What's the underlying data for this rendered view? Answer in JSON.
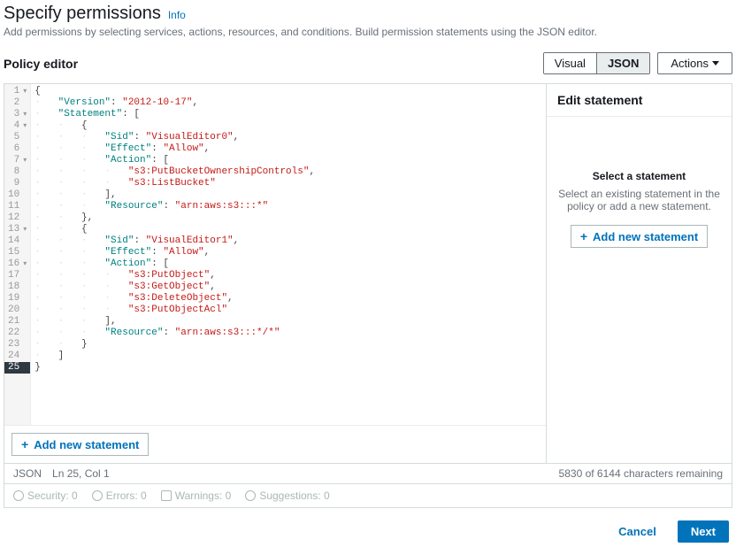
{
  "header": {
    "title": "Specify permissions",
    "info": "Info",
    "subtitle": "Add permissions by selecting services, actions, resources, and conditions. Build permission statements using the JSON editor."
  },
  "editor": {
    "title": "Policy editor",
    "toggle": {
      "visual": "Visual",
      "json": "JSON"
    },
    "actions": "Actions",
    "addStatement": "Add new statement"
  },
  "code": {
    "lines": [
      {
        "n": 1,
        "fold": true,
        "indent": 0,
        "content": "{"
      },
      {
        "n": 2,
        "fold": false,
        "indent": 1,
        "content": "\"Version\": \"2012-10-17\","
      },
      {
        "n": 3,
        "fold": true,
        "indent": 1,
        "content": "\"Statement\": ["
      },
      {
        "n": 4,
        "fold": true,
        "indent": 2,
        "content": "{"
      },
      {
        "n": 5,
        "fold": false,
        "indent": 3,
        "content": "\"Sid\": \"VisualEditor0\","
      },
      {
        "n": 6,
        "fold": false,
        "indent": 3,
        "content": "\"Effect\": \"Allow\","
      },
      {
        "n": 7,
        "fold": true,
        "indent": 3,
        "content": "\"Action\": ["
      },
      {
        "n": 8,
        "fold": false,
        "indent": 4,
        "content": "\"s3:PutBucketOwnershipControls\","
      },
      {
        "n": 9,
        "fold": false,
        "indent": 4,
        "content": "\"s3:ListBucket\""
      },
      {
        "n": 10,
        "fold": false,
        "indent": 3,
        "content": "],"
      },
      {
        "n": 11,
        "fold": false,
        "indent": 3,
        "content": "\"Resource\": \"arn:aws:s3:::*\""
      },
      {
        "n": 12,
        "fold": false,
        "indent": 2,
        "content": "},"
      },
      {
        "n": 13,
        "fold": true,
        "indent": 2,
        "content": "{"
      },
      {
        "n": 14,
        "fold": false,
        "indent": 3,
        "content": "\"Sid\": \"VisualEditor1\","
      },
      {
        "n": 15,
        "fold": false,
        "indent": 3,
        "content": "\"Effect\": \"Allow\","
      },
      {
        "n": 16,
        "fold": true,
        "indent": 3,
        "content": "\"Action\": ["
      },
      {
        "n": 17,
        "fold": false,
        "indent": 4,
        "content": "\"s3:PutObject\","
      },
      {
        "n": 18,
        "fold": false,
        "indent": 4,
        "content": "\"s3:GetObject\","
      },
      {
        "n": 19,
        "fold": false,
        "indent": 4,
        "content": "\"s3:DeleteObject\","
      },
      {
        "n": 20,
        "fold": false,
        "indent": 4,
        "content": "\"s3:PutObjectAcl\""
      },
      {
        "n": 21,
        "fold": false,
        "indent": 3,
        "content": "],"
      },
      {
        "n": 22,
        "fold": false,
        "indent": 3,
        "content": "\"Resource\": \"arn:aws:s3:::*/*\""
      },
      {
        "n": 23,
        "fold": false,
        "indent": 2,
        "content": "}"
      },
      {
        "n": 24,
        "fold": false,
        "indent": 1,
        "content": "]"
      },
      {
        "n": 25,
        "fold": false,
        "indent": 0,
        "content": "}",
        "selected": true
      }
    ]
  },
  "status": {
    "mode": "JSON",
    "cursor": "Ln 25, Col 1",
    "remaining": "5830 of 6144 characters remaining",
    "security": "Security: 0",
    "errors": "Errors: 0",
    "warnings": "Warnings: 0",
    "suggestions": "Suggestions: 0"
  },
  "side": {
    "header": "Edit statement",
    "selectTitle": "Select a statement",
    "selectDesc": "Select an existing statement in the policy or add a new statement.",
    "addBtn": "Add new statement"
  },
  "footer": {
    "cancel": "Cancel",
    "next": "Next"
  }
}
